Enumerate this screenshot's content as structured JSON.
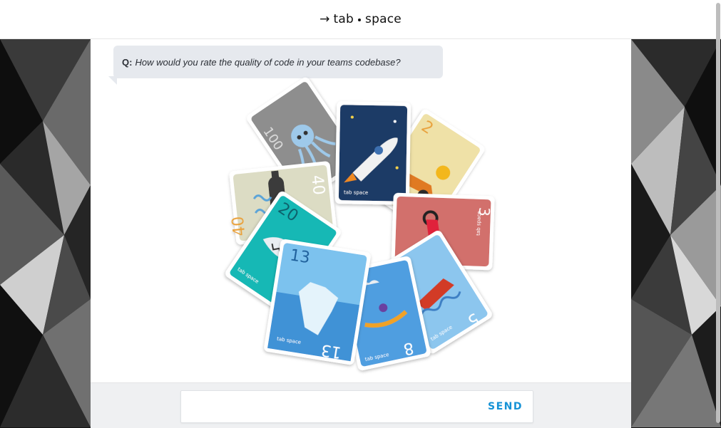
{
  "header": {
    "logo_arrow": "→",
    "logo_word1": "tab",
    "logo_word2": "space"
  },
  "question": {
    "prefix": "Q:",
    "text": "How would you rate the quality of code in your teams codebase?"
  },
  "cards": [
    {
      "value": "100",
      "theme": "octopus",
      "color": "#8e8e8e"
    },
    {
      "value": "40",
      "theme": "submarine",
      "color": "#dcdcc4"
    },
    {
      "value": "20",
      "theme": "shark",
      "color": "#17b8b5"
    },
    {
      "value": "13",
      "theme": "iceberg",
      "color": "#5aaee3"
    },
    {
      "value": "8",
      "theme": "canoe",
      "color": "#4f9ee0"
    },
    {
      "value": "5",
      "theme": "motorboat",
      "color": "#8cc6ee"
    },
    {
      "value": "3",
      "theme": "motorcycle",
      "color": "#d26f6c"
    },
    {
      "value": "2",
      "theme": "race-car",
      "color": "#efe1a7"
    },
    {
      "value": "",
      "theme": "rocket",
      "color": "#1a3a66"
    }
  ],
  "card_brand": "tab space",
  "answer": {
    "value": "",
    "placeholder": ""
  },
  "send_label": "SEND",
  "colors": {
    "accent": "#1592d6",
    "bubble": "#e6e9ee",
    "footer": "#eff0f2"
  }
}
